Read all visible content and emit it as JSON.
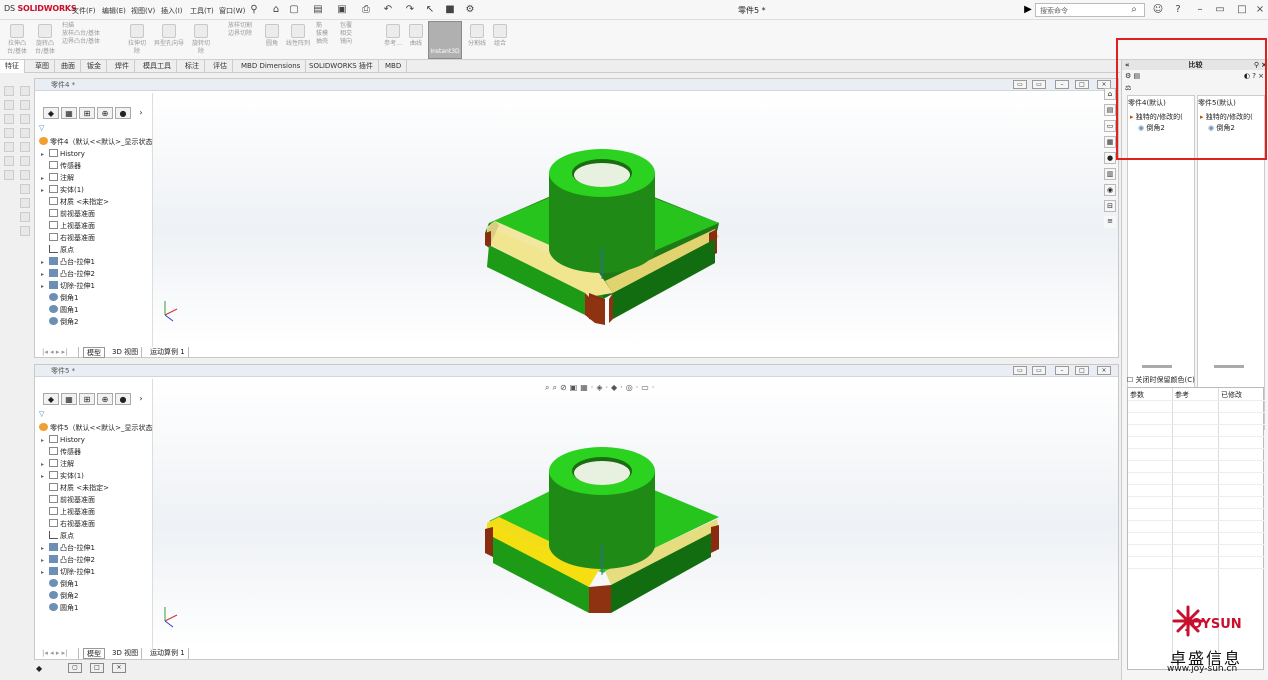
{
  "app": {
    "logo": "SOLIDWORKS",
    "logo_prefix": "DS",
    "doc_title": "零件5 *"
  },
  "menu": [
    "文件(F)",
    "编辑(E)",
    "视图(V)",
    "插入(I)",
    "工具(T)",
    "窗口(W)"
  ],
  "search": {
    "placeholder": "搜索命令"
  },
  "ribbon": {
    "buttons": [
      "拉伸凸台/基体",
      "旋转凸台/基体",
      "扫描",
      "放样凸台/基体",
      "边界凸台/基体",
      "拉伸切除",
      "异型孔向导",
      "旋转切除",
      "放样切割",
      "边界切除",
      "圆角",
      "线性阵列",
      "筋",
      "拔模",
      "包覆",
      "抽壳",
      "相交",
      "镜向",
      "参考...",
      "曲线",
      "分割线",
      "组合"
    ],
    "instant3d": "Instant3D"
  },
  "command_tabs": [
    "特征",
    "草图",
    "曲面",
    "钣金",
    "焊件",
    "模具工具",
    "标注",
    "评估",
    "MBD Dimensions",
    "SOLIDWORKS 插件",
    "MBD"
  ],
  "pane1": {
    "title": "零件4 *",
    "tree_root": "零件4（默认<<默认>_显示状态",
    "items": [
      "History",
      "传感器",
      "注解",
      "实体(1)",
      "材质 <未指定>",
      "前视基准面",
      "上视基准面",
      "右视基准面",
      "原点",
      "凸台-拉伸1",
      "凸台-拉伸2",
      "切除-拉伸1",
      "倒角1",
      "圆角1",
      "倒角2"
    ],
    "bottom_tabs": [
      "模型",
      "3D 视图",
      "运动算例 1"
    ]
  },
  "pane2": {
    "title": "零件5 *",
    "tree_root": "零件5（默认<<默认>_显示状态",
    "items": [
      "History",
      "传感器",
      "注解",
      "实体(1)",
      "材质 <未指定>",
      "前视基准面",
      "上视基准面",
      "右视基准面",
      "原点",
      "凸台-拉伸1",
      "凸台-拉伸2",
      "切除-拉伸1",
      "倒角1",
      "倒角2",
      "圆角1"
    ],
    "bottom_tabs": [
      "模型",
      "3D 视图",
      "运动算例 1"
    ]
  },
  "compare": {
    "title": "比较",
    "col1_header": "零件4(默认)",
    "col2_header": "零件5(默认)",
    "col1_feature": "独特的/修改的(",
    "col2_feature": "独特的/修改的(",
    "col1_item": "倒角2",
    "col2_item": "倒角2",
    "checkbox_label": "关闭时保留颜色(C)",
    "result_headers": [
      "参数",
      "参考",
      "已修改"
    ]
  },
  "watermark": {
    "brand": "JOYSUN",
    "chinese": "卓盛信息",
    "url": "www.joy-sun.cn"
  },
  "colors": {
    "highlight_box": "#e02020",
    "model_green": "#22b417",
    "chamfer_yellow": "#f0e28a",
    "fillet_brown": "#8b2a10"
  }
}
